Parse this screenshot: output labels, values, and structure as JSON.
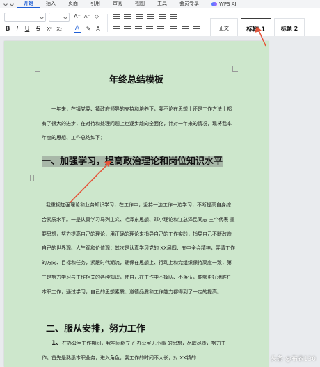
{
  "menubar": {
    "tabs": [
      {
        "label": "开始",
        "active": true
      },
      {
        "label": "插入",
        "active": false
      },
      {
        "label": "页面",
        "active": false
      },
      {
        "label": "引用",
        "active": false
      },
      {
        "label": "审阅",
        "active": false
      },
      {
        "label": "视图",
        "active": false
      },
      {
        "label": "工具",
        "active": false
      },
      {
        "label": "会员专享",
        "active": false
      }
    ],
    "wps_ai": "WPS AI"
  },
  "toolbar": {
    "bold": "B",
    "italic": "I",
    "underline": "U",
    "font_color": "A",
    "styles": {
      "normal": "正文",
      "heading1": "标题 1",
      "heading2": "标题 2"
    }
  },
  "document": {
    "title": "年终总结模板",
    "para1": "一年来，在镇党委、镇政府领导的支持和培养下，我不论在思想上还是工作方法上都有了很大的进步，在对待和处理问题上也逐步趋向全面化，针对一年来的情况，现将我本年度的思想、工作总结如下：",
    "heading1": "一、加强学习，提高政治理论和岗位知识水平",
    "para2": "我重视加强理论和业务知识学习，在工作中，坚持一边工作一边学习，不断提高自身综合素质水平。一是认真学习马列主义、毛泽东思想、邓小理论和江总泽民同志 三个代表 重要思想，努力提高自己的理论，用正确的理论来指导自己的工作实践，指导自己不断改造自己的世界观、人生观和价值观；其次是认真学习党的 XX届四、五中全会精神，弄清工作的方向、目标和任务，紧跟时代潮流，确保在思想上、行动上和党组织保持高度一致，第三是努力学习与工作相关的各种知识，使自己在工作中不掉队、不落伍，能够更好地胜任本职工作，通过学习，自己的思想素质、道德品质和工作能力都得到了一定的提高。",
    "heading2": "二、服从安排，努力工作",
    "para3_lead": "1、",
    "para3": "在办公室工作期间，我牢固树立了 办公室无小事 的思想，尽职尽责，努力工作。首先是熟悉本职业务，进入角色，我工作的时间不太长，对 XX镇的"
  },
  "watermark": "头条 @布衣130",
  "colors": {
    "page": "#cde7cc",
    "highlight": "#a8b8a8",
    "accent": "#1f5fd6",
    "arrow": "#e5543a"
  }
}
